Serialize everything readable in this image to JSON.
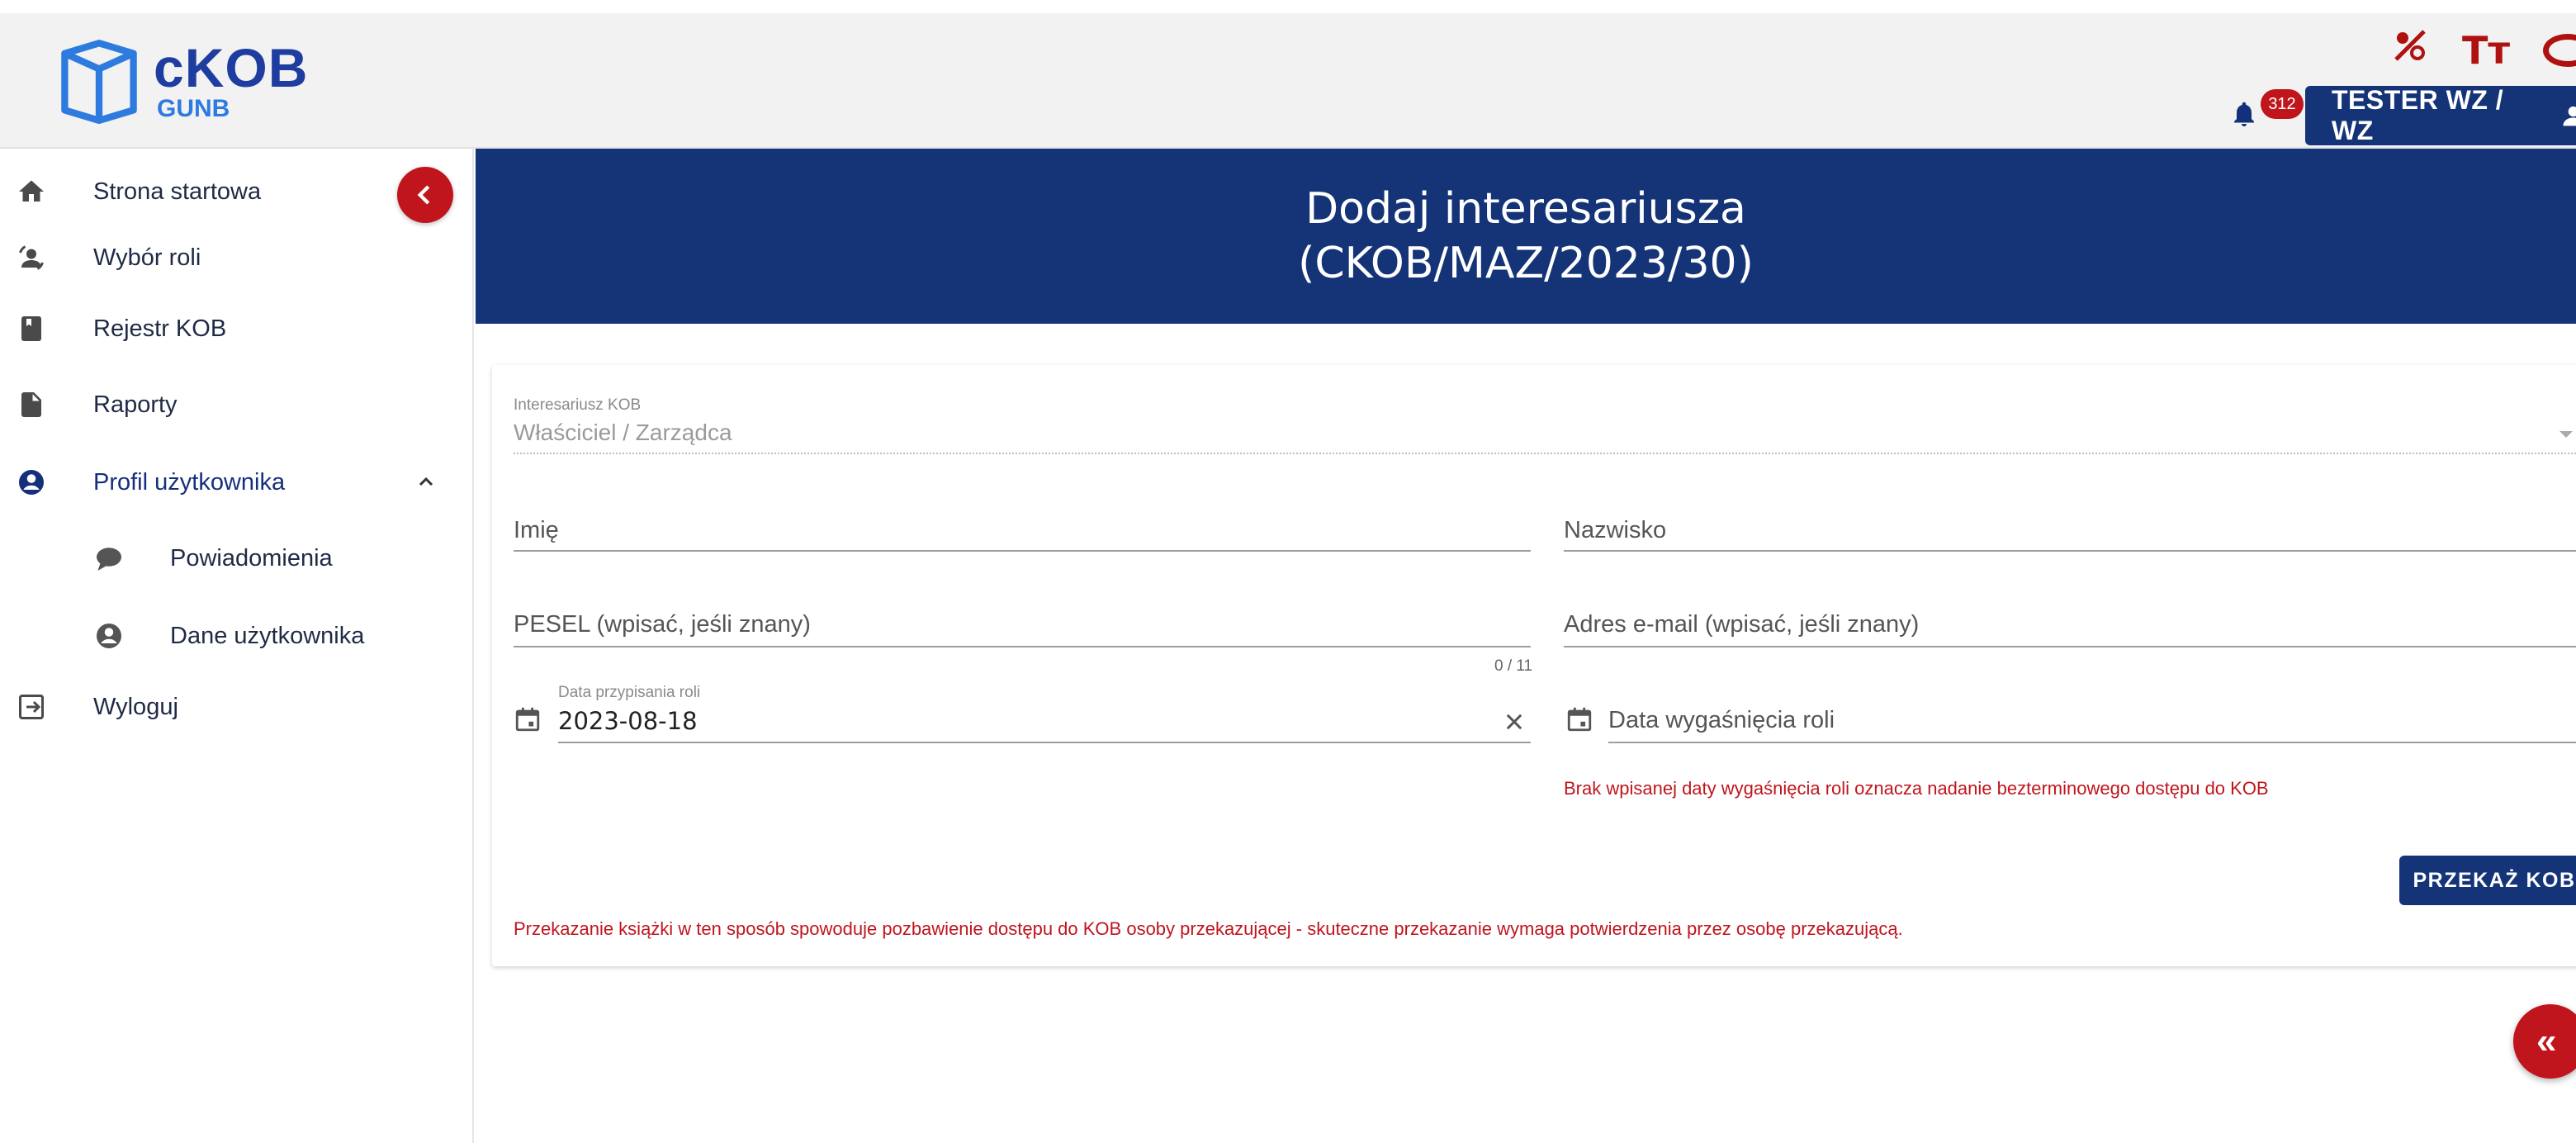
{
  "app": {
    "logo_main": "cKOB",
    "logo_sub": "GUNB",
    "notifications_count": "312",
    "user_label": "TESTER WZ / WZ",
    "brand_color": "#153478",
    "accent_color": "#c0151d"
  },
  "a11y": {
    "contrast_icon": "contrast-icon",
    "text_size_label": "Tт",
    "eye_icon": "eye-icon"
  },
  "sidebar": {
    "items": [
      {
        "label": "Strona startowa",
        "icon": "home-icon"
      },
      {
        "label": "Wybór roli",
        "icon": "role-switch-icon"
      },
      {
        "label": "Rejestr KOB",
        "icon": "book-icon"
      },
      {
        "label": "Raporty",
        "icon": "document-icon"
      },
      {
        "label": "Profil użytkownika",
        "icon": "account-circle-icon",
        "expanded": true
      },
      {
        "label": "Powiadomienia",
        "icon": "chat-bubble-icon"
      },
      {
        "label": "Dane użytkownika",
        "icon": "account-circle-icon"
      },
      {
        "label": "Wyloguj",
        "icon": "logout-icon"
      }
    ]
  },
  "banner": {
    "line1": "Dodaj interesariusza",
    "line2": "(CKOB/MAZ/2023/30)"
  },
  "form": {
    "stakeholder_label": "Interesariusz KOB",
    "stakeholder_value": "Właściciel / Zarządca",
    "first_name_placeholder": "Imię",
    "last_name_placeholder": "Nazwisko",
    "pesel_placeholder": "PESEL (wpisać, jeśli znany)",
    "pesel_counter": "0 / 11",
    "email_placeholder": "Adres e-mail (wpisać, jeśli znany)",
    "assign_date_label": "Data przypisania roli",
    "assign_date_value": "2023-08-18",
    "expiry_date_placeholder": "Data wygaśnięcia roli",
    "expiry_hint": "Brak wpisanej daty wygaśnięcia roli oznacza nadanie bezterminowego dostępu do KOB",
    "submit_label": "PRZEKAŻ KOB",
    "warning": "Przekazanie książki w ten sposób spowoduje pozbawienie dostępu do KOB osoby przekazującej - skuteczne przekazanie wymaga potwierdzenia przez osobę przekazującą."
  },
  "fab_label": "«"
}
